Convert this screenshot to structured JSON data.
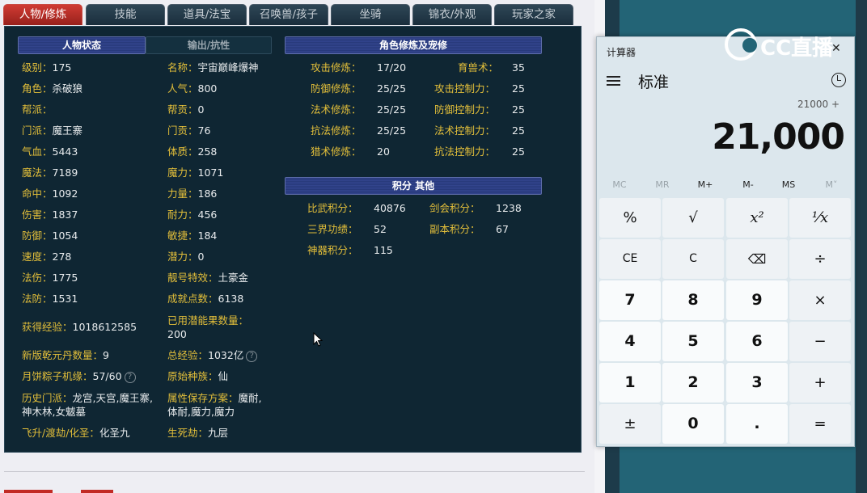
{
  "tabs": [
    "人物/修炼",
    "技能",
    "道具/法宝",
    "召唤兽/孩子",
    "坐骑",
    "锦衣/外观",
    "玩家之家"
  ],
  "headers": {
    "status": "人物状态",
    "output": "输出/抗性",
    "cultivation": "角色修炼及宠修",
    "points": "积分 其他"
  },
  "stats_left": [
    {
      "label": "级别：",
      "value": "175"
    },
    {
      "label": "角色：",
      "value": "杀破狼"
    },
    {
      "label": "帮派：",
      "value": ""
    },
    {
      "label": "门派：",
      "value": "魔王寨"
    },
    {
      "label": "气血：",
      "value": "5443"
    },
    {
      "label": "魔法：",
      "value": "7189"
    },
    {
      "label": "命中：",
      "value": "1092"
    },
    {
      "label": "伤害：",
      "value": "1837"
    },
    {
      "label": "防御：",
      "value": "1054"
    },
    {
      "label": "速度：",
      "value": "278"
    },
    {
      "label": "法伤：",
      "value": "1775"
    },
    {
      "label": "法防：",
      "value": "1531"
    }
  ],
  "stats_mid": [
    {
      "label": "名称：",
      "value": "宇宙巅峰爆神"
    },
    {
      "label": "人气：",
      "value": "800"
    },
    {
      "label": "帮贡：",
      "value": "0"
    },
    {
      "label": "门贡：",
      "value": "76"
    },
    {
      "label": "体质：",
      "value": "258"
    },
    {
      "label": "魔力：",
      "value": "1071"
    },
    {
      "label": "力量：",
      "value": "186"
    },
    {
      "label": "耐力：",
      "value": "456"
    },
    {
      "label": "敏捷：",
      "value": "184"
    },
    {
      "label": "潜力：",
      "value": "0"
    },
    {
      "label": "靓号特效：",
      "value": "土豪金"
    },
    {
      "label": "成就点数：",
      "value": "6138"
    }
  ],
  "exp": {
    "label": "获得经验：",
    "value": "1018612585"
  },
  "potential": {
    "label": "已用潜能果数量：",
    "value": "200"
  },
  "pill": {
    "label": "新版乾元丹数量：",
    "value": "9"
  },
  "total_exp": {
    "label": "总经验：",
    "value": "1032亿",
    "help": "?"
  },
  "mooncake": {
    "label": "月饼粽子机缘：",
    "value": "57/60",
    "help": "?"
  },
  "race": {
    "label": "原始种族：",
    "value": "仙"
  },
  "history": {
    "label": "历史门派：",
    "value": "龙宫,天宫,魔王寨,神木林,女魃墓"
  },
  "save_plan": {
    "label": "属性保存方案：",
    "value": "魔耐,体耐,魔力,魔力"
  },
  "ascend": {
    "label": "飞升/渡劫/化圣：",
    "value": "化圣九"
  },
  "life_death": {
    "label": "生死劫：",
    "value": "九层"
  },
  "cultivation_left": [
    {
      "label": "攻击修炼：",
      "value": "17/20"
    },
    {
      "label": "防御修炼：",
      "value": "25/25"
    },
    {
      "label": "法术修炼：",
      "value": "25/25"
    },
    {
      "label": "抗法修炼：",
      "value": "25/25"
    },
    {
      "label": "猎术修炼：",
      "value": "20"
    }
  ],
  "cultivation_right": [
    {
      "label": "育兽术：",
      "value": "35"
    },
    {
      "label": "攻击控制力：",
      "value": "25"
    },
    {
      "label": "防御控制力：",
      "value": "25"
    },
    {
      "label": "法术控制力：",
      "value": "25"
    },
    {
      "label": "抗法控制力：",
      "value": "25"
    }
  ],
  "points_left": [
    {
      "label": "比武积分：",
      "value": "40876"
    },
    {
      "label": "三界功绩：",
      "value": "52"
    },
    {
      "label": "神器积分：",
      "value": "115"
    }
  ],
  "points_right": [
    {
      "label": "剑会积分：",
      "value": "1238"
    },
    {
      "label": "副本积分：",
      "value": "67"
    }
  ],
  "calculator": {
    "title": "计算器",
    "mode": "标准",
    "expression": "21000 +",
    "display": "21,000",
    "memory": [
      "MC",
      "MR",
      "M+",
      "M-",
      "MS",
      "M˅"
    ],
    "keys": [
      [
        "%",
        "√",
        "x²",
        "¹⁄x"
      ],
      [
        "CE",
        "C",
        "⌫",
        "÷"
      ],
      [
        "7",
        "8",
        "9",
        "×"
      ],
      [
        "4",
        "5",
        "6",
        "−"
      ],
      [
        "1",
        "2",
        "3",
        "+"
      ],
      [
        "±",
        "0",
        ".",
        "="
      ]
    ],
    "close": "✕"
  },
  "watermark": "CC直播"
}
